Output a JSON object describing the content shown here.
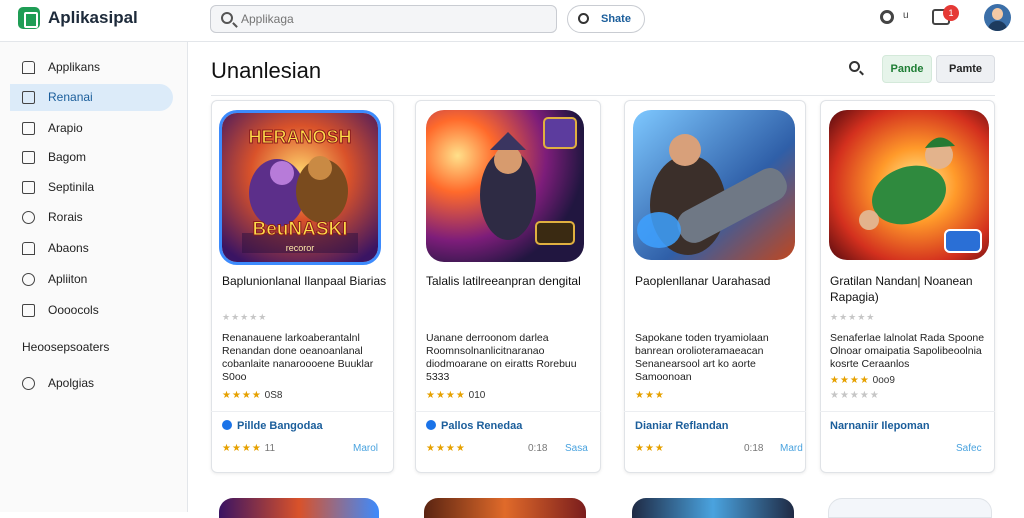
{
  "header": {
    "app_title": "Aplikasipal",
    "search_placeholder": "Applikaga",
    "share_label": "Shate",
    "gear_suffix": "u",
    "notification_count": "1"
  },
  "sidebar": {
    "items": [
      {
        "label": "Applikans",
        "icon": "home-icon"
      },
      {
        "label": "Renanai",
        "icon": "calendar-icon"
      },
      {
        "label": "Arapio",
        "icon": "briefcase-icon"
      },
      {
        "label": "Bagom",
        "icon": "grid-icon"
      },
      {
        "label": "Septinila",
        "icon": "monitor-icon"
      },
      {
        "label": "Rorais",
        "icon": "link-icon"
      },
      {
        "label": "Abaons",
        "icon": "shield-icon"
      },
      {
        "label": "Apliiton",
        "icon": "cog-icon"
      },
      {
        "label": "Oooocols",
        "icon": "list-icon"
      }
    ],
    "section_label": "Heoosepsoaters",
    "extra_item": {
      "label": "Apolgias",
      "icon": "link-icon"
    }
  },
  "main": {
    "title": "Unanlesian",
    "primary_button": "Pande",
    "secondary_button": "Pamte"
  },
  "cards": [
    {
      "art_title_1": "HERANOSH",
      "art_title_2": "BeuNASKI",
      "art_subtitle": "recoror",
      "name": "Baplunionlanal Ilanpaal Biarias",
      "desc": "Renanauene larkoaberantalnl Renandan done oeanoanlanal cobanlaite nanaroooene Buuklar S0oo",
      "rating_stars": "★★★★",
      "rating_value": "0S8",
      "developer": "Pillde Bangodaa",
      "foot_stars": "★★★★",
      "foot_count": "11",
      "foot_link": "Marol"
    },
    {
      "art_title_1": "",
      "art_title_2": "",
      "art_subtitle": "",
      "name": "Talalis latilreeanpran dengital",
      "desc": "Uanane derroonom darlea Roomnsolnanlicitnaranao diodmoarane on eiratts Rorebuu 5333",
      "rating_stars": "★★★★",
      "rating_value": "010",
      "developer": "Pallos Renedaa",
      "foot_stars": "★★★★",
      "foot_count": "0:18",
      "foot_link": "Sasa"
    },
    {
      "art_title_1": "",
      "art_title_2": "",
      "art_subtitle": "",
      "name": "Paoplenllanar Uarahasad",
      "desc": "Sapokane toden tryamiolaan banrean orolioteramaeacan Senanearsool art ko aorte Samoonoan",
      "rating_stars": "★★★",
      "rating_value": "",
      "developer": "Dianiar Reflandan",
      "foot_stars": "★★★",
      "foot_count": "0:18",
      "foot_link": "Mard"
    },
    {
      "art_title_1": "",
      "art_title_2": "",
      "art_subtitle": "",
      "name": "Gratilan Nandan| Noanean Rapagia)",
      "desc": "Senaferlae lalnolat Rada Spoone Olnoar omaipatia Sapolibeoolnia kosrte Ceraanlos",
      "rating_stars": "★★★★",
      "rating_value": "0oo9",
      "developer": "Narnaniir Ilepoman",
      "foot_stars": "",
      "foot_count": "",
      "foot_link": "Safec"
    }
  ],
  "colors": {
    "accent_blue": "#1b5e9b",
    "sidebar_active": "#dcebf9",
    "star": "#e6a100",
    "badge_red": "#e53935",
    "brand_green": "#1f9d55"
  }
}
